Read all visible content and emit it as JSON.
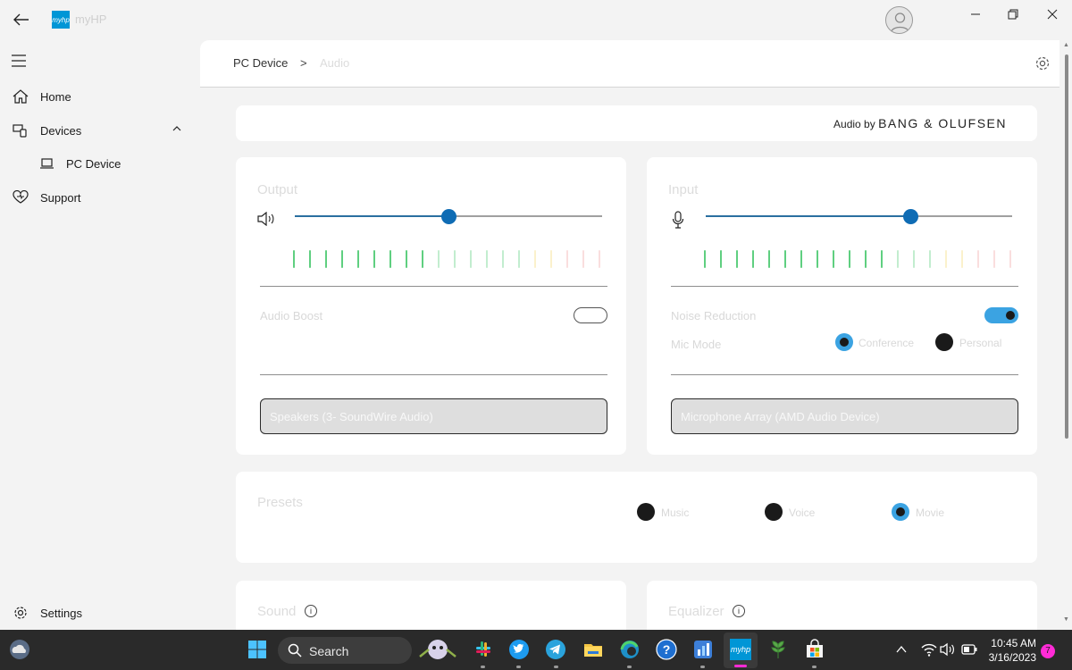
{
  "app": {
    "logo_text": "myhp",
    "name": "myHP"
  },
  "sidebar": {
    "items": [
      {
        "label": "Home"
      },
      {
        "label": "Devices"
      },
      {
        "label": "PC Device"
      },
      {
        "label": "Support"
      },
      {
        "label": "Settings"
      }
    ]
  },
  "breadcrumb": {
    "root": "PC Device",
    "separator": ">",
    "current": "Audio"
  },
  "banner": {
    "prefix": "Audio by",
    "brand": "BANG & OLUFSEN"
  },
  "output": {
    "title": "Output",
    "volume": 0.5,
    "meter_active": 9,
    "audio_boost_label": "Audio Boost",
    "audio_boost_on": false,
    "device": "Speakers (3- SoundWire Audio)"
  },
  "input": {
    "title": "Input",
    "volume": 0.67,
    "meter_active": 12,
    "noise_reduction_label": "Noise Reduction",
    "noise_reduction_on": true,
    "mic_mode_label": "Mic Mode",
    "mic_modes": [
      "Conference",
      "Personal"
    ],
    "mic_mode_selected": "Conference",
    "device": "Microphone Array (AMD Audio Device)"
  },
  "presets": {
    "title": "Presets",
    "options": [
      "Music",
      "Voice",
      "Movie"
    ],
    "selected": "Movie"
  },
  "sound": {
    "title": "Sound"
  },
  "equalizer": {
    "title": "Equalizer"
  },
  "taskbar": {
    "search_label": "Search",
    "time": "10:45 AM",
    "date": "3/16/2023",
    "notification_count": "7"
  },
  "colors": {
    "accent": "#0f6cb4",
    "toggle_on": "#3ba3e2",
    "meter_green": "#5fcf80",
    "meter_yellow": "#f5d97a",
    "meter_red": "#f2a7a7"
  }
}
